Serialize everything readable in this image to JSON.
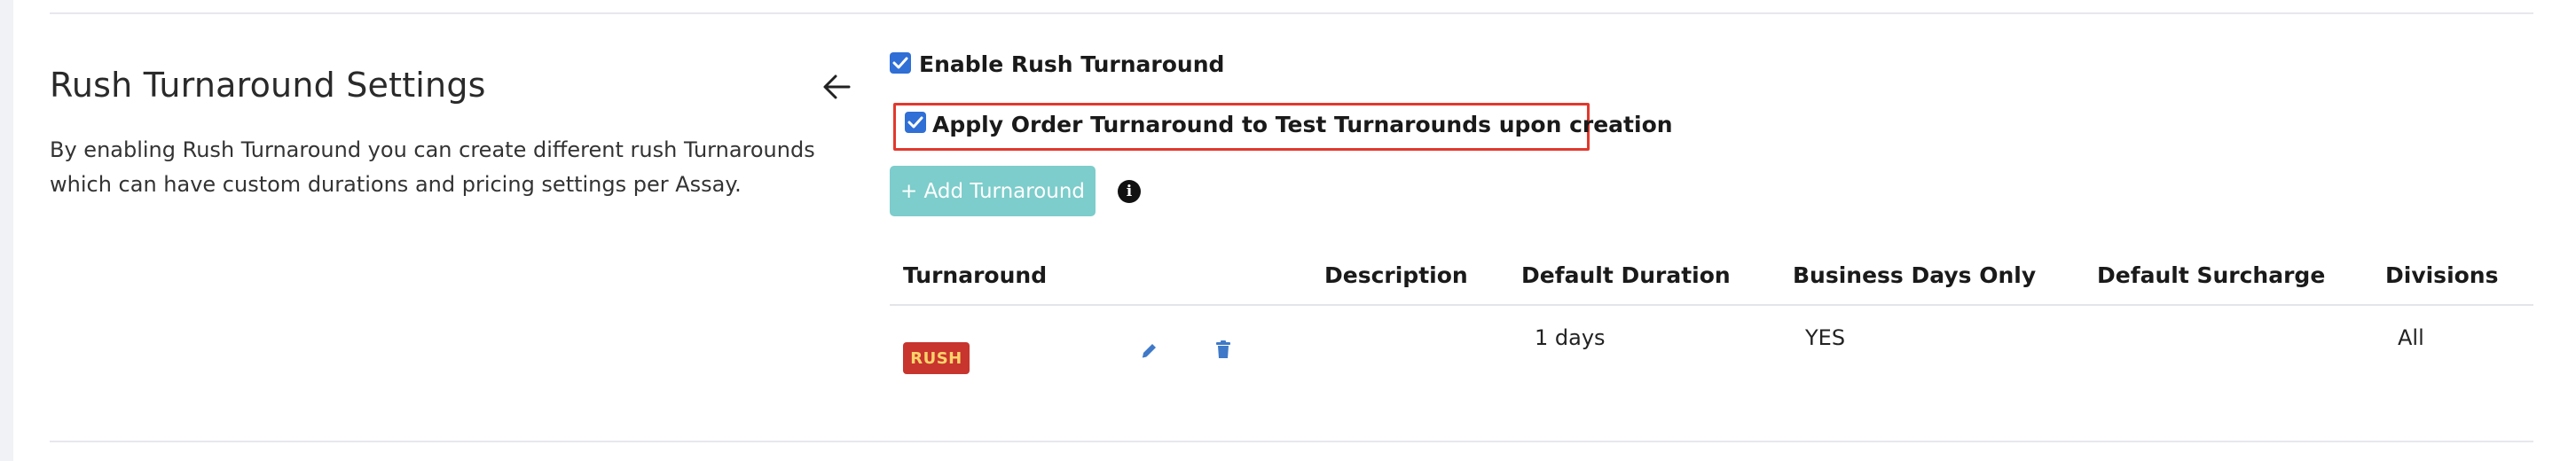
{
  "section": {
    "title": "Rush Turnaround Settings",
    "description": "By enabling Rush Turnaround you can create different rush Turnarounds which can have custom durations and pricing settings per Assay."
  },
  "options": {
    "enable_rush": {
      "label": "Enable Rush Turnaround",
      "checked": true
    },
    "apply_order": {
      "label": "Apply Order Turnaround to Test Turnarounds upon creation",
      "checked": true
    }
  },
  "add_button": {
    "label": "+ Add Turnaround"
  },
  "info_icon": {
    "glyph": "i",
    "icon": "info-icon"
  },
  "table": {
    "headers": {
      "turnaround": "Turnaround",
      "description": "Description",
      "default_duration": "Default Duration",
      "business_days_only": "Business Days Only",
      "default_surcharge": "Default Surcharge",
      "divisions": "Divisions"
    },
    "rows": [
      {
        "badge": "RUSH",
        "description": "",
        "default_duration": "1 days",
        "business_days_only": "YES",
        "default_surcharge": "",
        "divisions": "All"
      }
    ]
  },
  "colors": {
    "checkbox": "#2f6fd6",
    "highlight_border": "#e2382d",
    "add_button_bg": "#7ccdcb",
    "badge_bg": "#c8342e",
    "badge_text": "#ffd46a",
    "action_icon": "#3f79c8"
  }
}
